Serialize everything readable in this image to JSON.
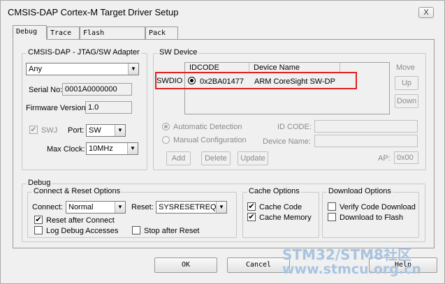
{
  "window": {
    "title": "CMSIS-DAP Cortex-M Target Driver Setup",
    "close_label": "X"
  },
  "tabs": [
    {
      "label": "Debug"
    },
    {
      "label": "Trace"
    },
    {
      "label": "Flash Download"
    },
    {
      "label": "Pack"
    }
  ],
  "adapter": {
    "group_title": "CMSIS-DAP - JTAG/SW Adapter",
    "selected_adapter": "Any",
    "serial_label": "Serial No:",
    "serial_value": "0001A0000000",
    "firmware_label": "Firmware Version:",
    "firmware_value": "1.0",
    "swj_label": "SWJ",
    "swj_checked": "✔",
    "port_label": "Port:",
    "port_value": "SW",
    "maxclock_label": "Max Clock:",
    "maxclock_value": "10MHz"
  },
  "sw_device": {
    "group_title": "SW Device",
    "col_idcode": "IDCODE",
    "col_device": "Device Name",
    "row_label": "SWDIO",
    "row_idcode": "0x2BA01477",
    "row_device": "ARM CoreSight SW-DP",
    "move_label": "Move",
    "up_label": "Up",
    "down_label": "Down",
    "auto_detect_label": "Automatic Detection",
    "manual_config_label": "Manual Configuration",
    "id_code_label": "ID CODE:",
    "device_name_label": "Device Name:",
    "ap_label": "AP:",
    "ap_value": "0x00",
    "add_label": "Add",
    "delete_label": "Delete",
    "update_label": "Update"
  },
  "debug": {
    "group_title": "Debug",
    "connect_reset": {
      "group_title": "Connect & Reset Options",
      "connect_label": "Connect:",
      "connect_value": "Normal",
      "reset_label": "Reset:",
      "reset_value": "SYSRESETREQ",
      "reset_after_connect": "Reset after Connect",
      "log_debug_accesses": "Log Debug Accesses",
      "stop_after_reset": "Stop after Reset",
      "check_mark": "✔"
    },
    "cache": {
      "group_title": "Cache Options",
      "cache_code": "Cache Code",
      "cache_memory": "Cache Memory",
      "check_mark": "✔"
    },
    "download": {
      "group_title": "Download Options",
      "verify_code": "Verify Code Download",
      "download_flash": "Download to Flash"
    }
  },
  "footer": {
    "ok_label": "OK",
    "cancel_label": "Cancel",
    "help_label": "Help"
  },
  "watermark": {
    "line1": "STM32/STM8社区",
    "line2": "www.stmcu.org.cn"
  }
}
